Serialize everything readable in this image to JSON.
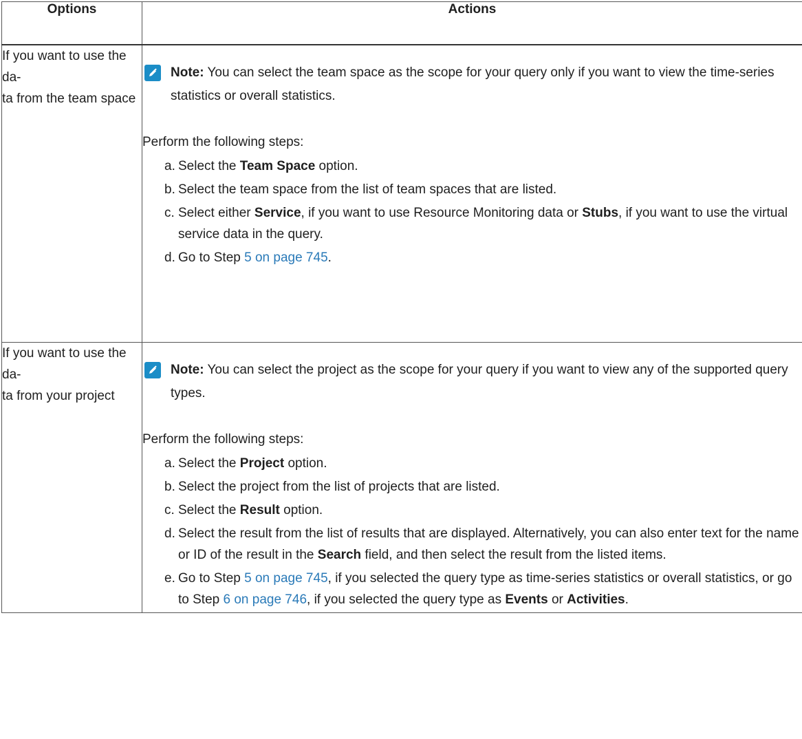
{
  "headers": {
    "options": "Options",
    "actions": "Actions"
  },
  "note_icon": "pencil-icon",
  "accent": "#1b8dc7",
  "rows": [
    {
      "option_line1": "If you want to use the da-",
      "option_line2": "ta from the team space",
      "note_label": "Note:",
      "note_text": "You can select the team space as the scope for your query only if you want to view the time-series statistics or overall statistics.",
      "lead": "Perform the following steps:",
      "steps": {
        "a": {
          "marker": "a.",
          "pre": "Select the ",
          "bold": "Team Space",
          "post": " option."
        },
        "b": {
          "marker": "b.",
          "text": "Select the team space from the list of team spaces that are listed."
        },
        "c": {
          "marker": "c.",
          "pre": "Select either ",
          "bold1": "Service",
          "mid": ", if you want to use Resource Monitoring data or ",
          "bold2": "Stubs",
          "post": ", if you want to use the virtual service data in the query."
        },
        "d": {
          "marker": "d.",
          "pre": "Go to Step ",
          "link": "5 on page 745",
          "post": "."
        }
      }
    },
    {
      "option_line1": "If you want to use the da-",
      "option_line2": "ta from your project",
      "note_label": "Note:",
      "note_text": "You can select the project as the scope for your query if you want to view any of the supported query types.",
      "lead": "Perform the following steps:",
      "steps": {
        "a": {
          "marker": "a.",
          "pre": "Select the ",
          "bold": "Project",
          "post": " option."
        },
        "b": {
          "marker": "b.",
          "text": "Select the project from the list of projects that are listed."
        },
        "c": {
          "marker": "c.",
          "pre": "Select the ",
          "bold": "Result",
          "post": " option."
        },
        "d": {
          "marker": "d.",
          "pre": "Select the result from the list of results that are displayed. Alternatively, you can also enter text for the name or ID of the result in the ",
          "bold": "Search",
          "post": " field, and then select the result from the listed items."
        },
        "e": {
          "marker": "e.",
          "pre": "Go to Step ",
          "link1": "5 on page 745",
          "mid1": ", if you selected the query type as time-series statistics or overall statistics, or go to Step ",
          "link2": "6 on page 746",
          "mid2": ", if you selected the query type as ",
          "bold1": "Events",
          "mid3": " or ",
          "bold2": "Activities",
          "post": "."
        }
      }
    }
  ]
}
